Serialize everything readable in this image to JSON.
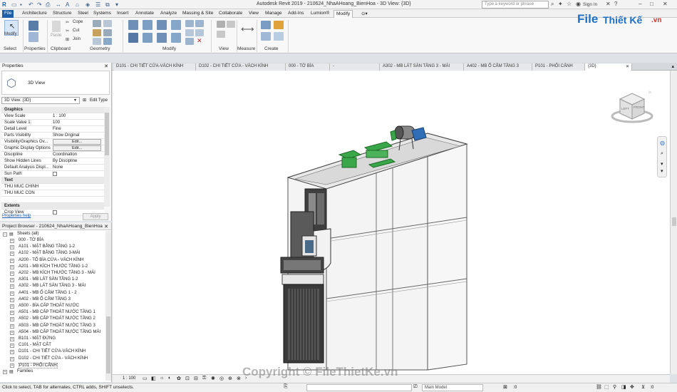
{
  "titlebar": {
    "title": "Autodesk Revit 2019 - 210624_NhaAHoang_BienHoa - 3D View: {3D}",
    "search_placeholder": "Type a keyword or phrase",
    "sign_in": "Sign In"
  },
  "tabs": [
    "File",
    "Architecture",
    "Structure",
    "Steel",
    "Systems",
    "Insert",
    "Annotate",
    "Analyze",
    "Massing & Site",
    "Collaborate",
    "View",
    "Manage",
    "Add-Ins",
    "Lumion®",
    "Modify"
  ],
  "ribbon": {
    "modify_label": "Modify",
    "select_label": "Select",
    "properties_label": "Properties",
    "clipboard_label": "Clipboard",
    "paste_label": "Paste",
    "cope_label": "Cope",
    "cut_label": "Cut",
    "join_label": "Join",
    "geometry_label": "Geometry",
    "modify_panel_label": "Modify",
    "view_label": "View",
    "measure_label": "Measure",
    "create_label": "Create"
  },
  "logo": {
    "text_file": "File",
    "text_rest": "Thiết Kế",
    "text_vn": ".vn"
  },
  "properties": {
    "header": "Properties",
    "type_name": "3D View",
    "selector": "3D View: {3D}",
    "edit_type": "Edit Type",
    "rows": [
      {
        "k": "Graphics",
        "v": "",
        "sec": true
      },
      {
        "k": "View Scale",
        "v": "1 : 100"
      },
      {
        "k": "Scale Value    1:",
        "v": "100"
      },
      {
        "k": "Detail Level",
        "v": "Fine"
      },
      {
        "k": "Parts Visibility",
        "v": "Show Original"
      },
      {
        "k": "Visibility/Graphics Ov...",
        "v": "Edit...",
        "btn": true
      },
      {
        "k": "Graphic Display Options",
        "v": "Edit...",
        "btn": true
      },
      {
        "k": "Discipline",
        "v": "Coordination"
      },
      {
        "k": "Show Hidden Lines",
        "v": "By Discipline"
      },
      {
        "k": "Default Analysis Displ...",
        "v": "None"
      },
      {
        "k": "Sun Path",
        "v": ""
      },
      {
        "k": "Text",
        "v": "",
        "sec": true
      },
      {
        "k": "THU MUC CHINH",
        "v": ""
      },
      {
        "k": "THU MUC CON",
        "v": ""
      },
      {
        "k": "",
        "v": ""
      },
      {
        "k": "Extents",
        "v": "",
        "sec": true
      },
      {
        "k": "Crop View",
        "v": ""
      }
    ],
    "help": "Properties help",
    "apply": "Apply"
  },
  "browser": {
    "header": "Project Browser - 210624_NhaAHoang_BienHoa",
    "sheets": "Sheets (all)",
    "items": [
      "000 - TỜ BÌA",
      "A101 - MẶT BẰNG TẦNG 1-2",
      "A102 - MẶT BẰNG TẦNG 3-MÁI",
      "A200 - TỔ BÌA CỬA - VÁCH KÍNH",
      "A201 - MB KÍCH THƯỚC TẦNG 1-2",
      "A202 - MB KÍCH THƯỚC TẦNG 3 - MÁI",
      "A301 - MB LÁT SÀN TẦNG 1-2",
      "A302 - MB LÁT SÀN TẦNG 3 - MÁI",
      "A401 - MB Ổ CẮM TẦNG 1 - 2",
      "A402 - MB Ổ CẮM TẦNG 3",
      "A500 - BÌA CẤP THOÁT NƯỚC",
      "A501 - MB CẤP THOÁT NƯỚC TẦNG 1",
      "A502 - MB CẤP THOÁT NƯỚC TẦNG 2",
      "A503 - MB CẤP THOÁT NƯỚC TẦNG 3",
      "A504 - MB CẤP THOÁT NƯỚC TẦNG MÁI",
      "B101 - MẶT ĐỨNG",
      "C101 - MẶT CẮT",
      "D101 - CHI TIẾT CỬA-VÁCH KÍNH",
      "D102 - CHI TIẾT CỬA - VÁCH KÍNH",
      "P101 - PHỐI CẢNH"
    ],
    "families": "Families"
  },
  "view_tabs": [
    "D101 - CHI TIẾT CỬA-VÁCH KÍNH",
    "D102 - CHI TIẾT CỬA - VÁCH KÍNH",
    "000 - TỜ BÌA",
    "-",
    "A302 - MB LÁT SÀN TẦNG 3 - MÁI",
    "A402 - MB Ổ CẮM TẦNG 3",
    "P101 - PHỐI CẢNH",
    "{3D}"
  ],
  "viewcube": {
    "left": "LEFT",
    "front": "FRONT"
  },
  "view_control": {
    "scale": "1 : 100"
  },
  "status": {
    "hint": "Click to select, TAB for alternates, CTRL adds, SHIFT unselects.",
    "model": "Main Model",
    "zero": ":0"
  },
  "copyright": "Copyright © FileThietKe.vn",
  "colors": {
    "file_tab": "#1e5fa8",
    "logo_blue": "#1e6fc4",
    "logo_red": "#d6312a",
    "green": "#3aa64a"
  }
}
